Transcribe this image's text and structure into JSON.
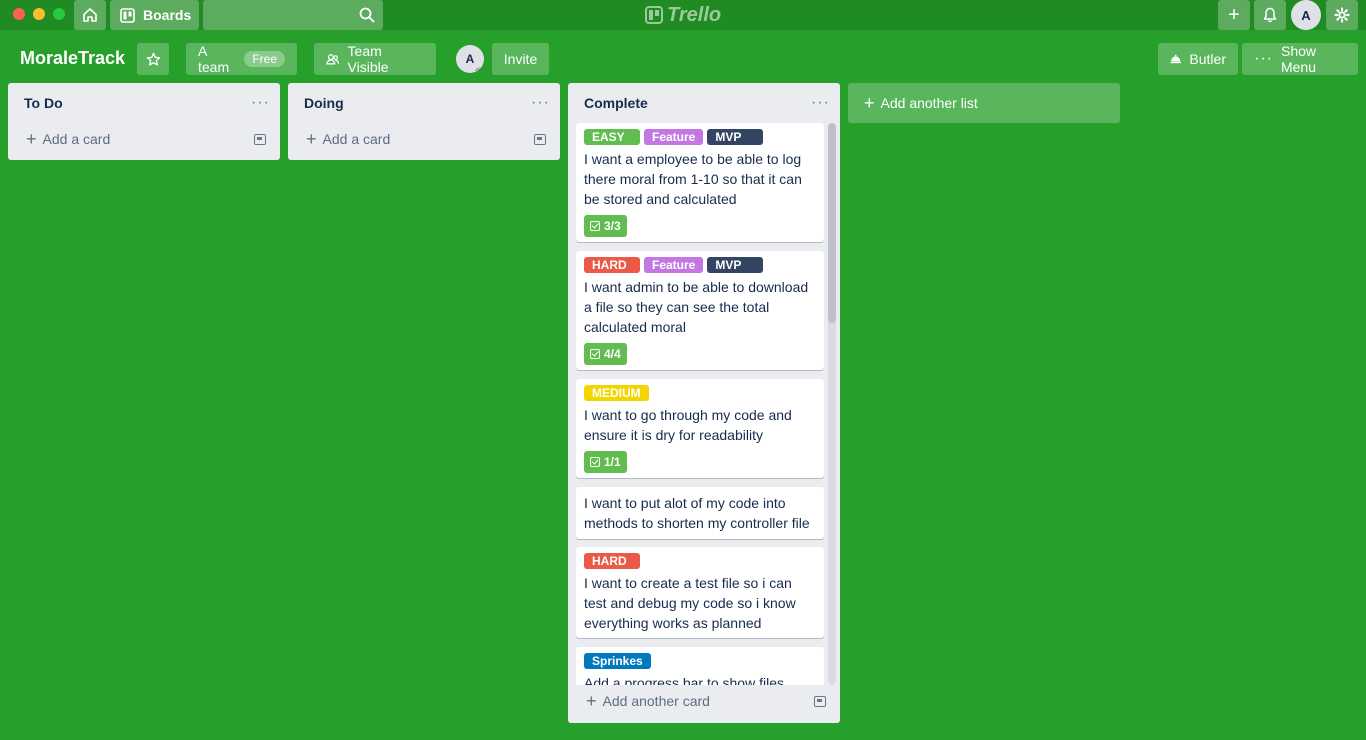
{
  "topbar": {
    "boards_label": "Boards",
    "logo_text": "Trello",
    "avatar_initial": "A"
  },
  "board": {
    "title": "MoraleTrack",
    "team_label": "A team",
    "team_badge": "Free",
    "visibility_label": "Team Visible",
    "member_initial": "A",
    "invite_label": "Invite",
    "butler_label": "Butler",
    "show_menu_label": "Show Menu"
  },
  "lists": {
    "todo": {
      "title": "To Do",
      "add_card": "Add a card"
    },
    "doing": {
      "title": "Doing",
      "add_card": "Add a card"
    },
    "complete": {
      "title": "Complete",
      "add_card": "Add another card"
    }
  },
  "add_list_label": "Add another list",
  "cards": [
    {
      "labels": [
        {
          "text": "EASY",
          "color": "#61bd4f"
        },
        {
          "text": "Feature",
          "color": "#c377e0"
        },
        {
          "text": "MVP",
          "color": "#344563"
        }
      ],
      "text": "I want a employee to be able to log there moral from 1-10 so that it can be stored and calculated",
      "checklist": "3/3"
    },
    {
      "labels": [
        {
          "text": "HARD",
          "color": "#eb5a46"
        },
        {
          "text": "Feature",
          "color": "#c377e0"
        },
        {
          "text": "MVP",
          "color": "#344563"
        }
      ],
      "text": "I want admin to be able to download a file so they can see the total calculated moral",
      "checklist": "4/4"
    },
    {
      "labels": [
        {
          "text": "MEDIUM",
          "color": "#f2d600"
        }
      ],
      "text": "I want to go through my code and ensure it is dry for readability",
      "checklist": "1/1"
    },
    {
      "labels": [],
      "text": "I want to put alot of my code into methods to shorten my controller file",
      "checklist": ""
    },
    {
      "labels": [
        {
          "text": "HARD",
          "color": "#eb5a46"
        }
      ],
      "text": "I want to create a test file so i can test and debug my code so i know everything works as planned",
      "checklist": ""
    },
    {
      "labels": [
        {
          "text": "Sprinkes",
          "color": "#0079bf"
        }
      ],
      "text": "Add a progress bar to show files",
      "checklist": ""
    }
  ],
  "colors": {
    "board_bg": "#27a02b",
    "topbar_bg": "#1f8b22",
    "list_bg": "#ebecf0"
  }
}
